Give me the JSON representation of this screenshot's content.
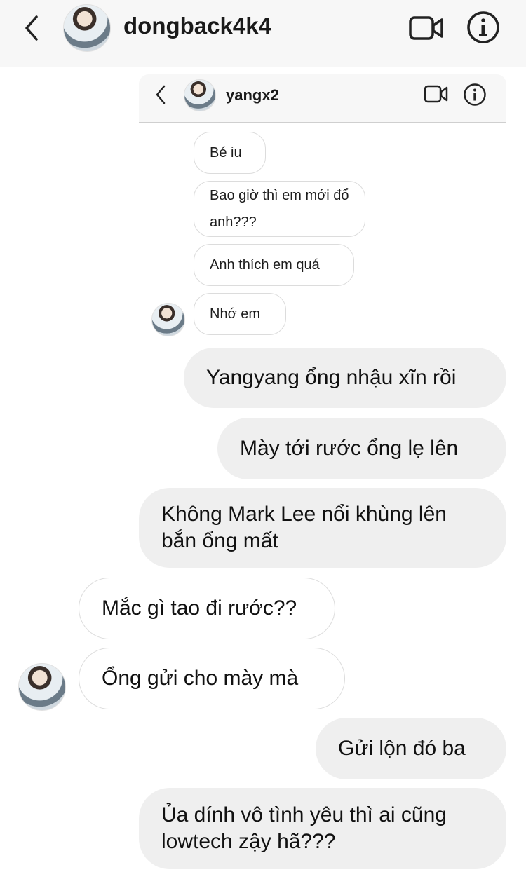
{
  "header": {
    "username": "dongback4k4",
    "back_icon": "chevron-left-icon",
    "video_icon": "video-camera-icon",
    "info_icon": "info-icon"
  },
  "embedded": {
    "username": "yangx2",
    "messages": [
      "Bé iu",
      "Bao giờ thì em mới đổ anh???",
      "Anh thích em quá",
      "Nhớ em"
    ]
  },
  "messages": [
    {
      "side": "out",
      "text": "Yangyang ổng nhậu xĩn rồi"
    },
    {
      "side": "out",
      "text": "Mày tới rước ổng lẹ lên"
    },
    {
      "side": "out",
      "text": "Không Mark Lee nổi khùng lên bắn ổng mất"
    },
    {
      "side": "in",
      "text": "Mắc gì tao đi rước??"
    },
    {
      "side": "in",
      "text": "Ổng gửi cho mày mà"
    },
    {
      "side": "out",
      "text": "Gửi lộn đó ba"
    },
    {
      "side": "out",
      "text": "Ủa dính vô tình yêu thì ai cũng lowtech zậy hã???"
    }
  ],
  "colors": {
    "outgoing_bubble": "#efefef",
    "incoming_border": "#dcdcdc",
    "header_bg": "#f7f7f7"
  }
}
